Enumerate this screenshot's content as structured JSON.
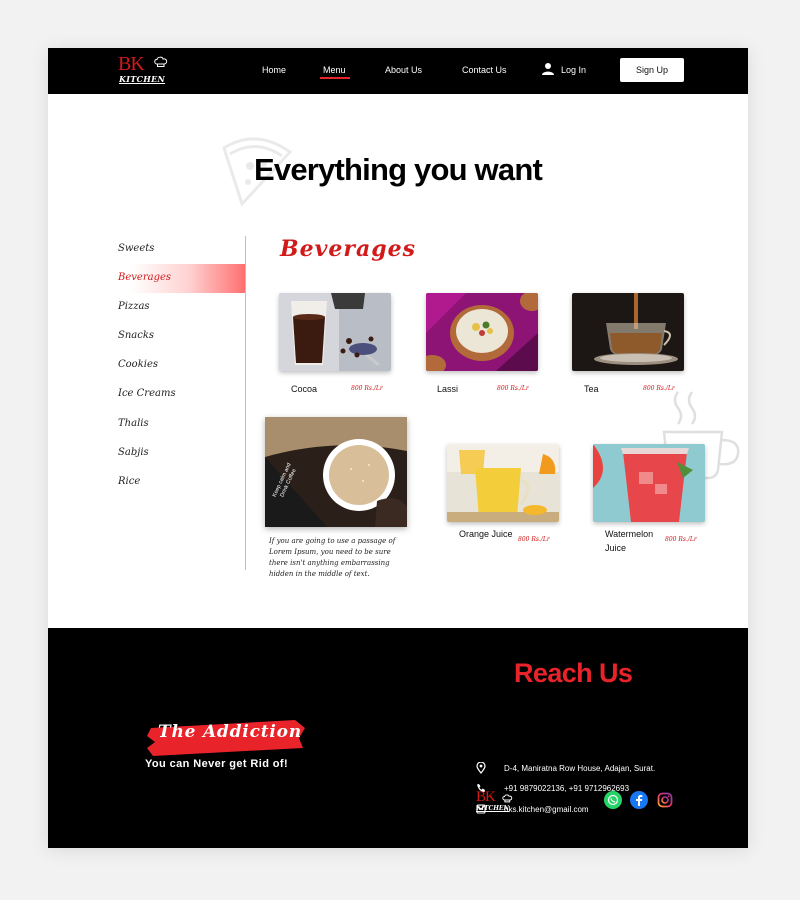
{
  "brand": {
    "logo_text": "BK",
    "logo_sub": "KITCHEN"
  },
  "nav": {
    "home": "Home",
    "menu": "Menu",
    "about": "About Us",
    "contact": "Contact Us",
    "login": "Log In",
    "signup": "Sign Up",
    "active": "Menu"
  },
  "hero": {
    "title": "Everything you want"
  },
  "sidebar": {
    "items": [
      "Sweets",
      "Beverages",
      "Pizzas",
      "Snacks",
      "Cookies",
      "Ice Creams",
      "Thalis",
      "Sabjis",
      "Rice"
    ],
    "active": "Beverages"
  },
  "content": {
    "section_title": "Beverages",
    "items": [
      {
        "name": "Cocoa",
        "price": "800 Rs./Lr"
      },
      {
        "name": "Lassi",
        "price": "800 Rs./Lr"
      },
      {
        "name": "Tea",
        "price": "800 Rs./Lr"
      },
      {
        "name": "Orange Juice",
        "price": "800 Rs./Lr"
      },
      {
        "name": "Watermelon Juice",
        "price": "800 Rs./Lr"
      }
    ],
    "featured": {
      "image_caption": "Keep calm and Drink Coffee",
      "text": "If you are going to use a passage of Lorem Ipsum, you need to be sure there isn't anything embarrassing hidden in the middle of text."
    }
  },
  "footer": {
    "addiction": "The Addiction",
    "tagline": "You can Never get Rid of!",
    "reach_title": "Reach Us",
    "address": "D-4, Maniratna Row House, Adajan, Surat.",
    "phone": "+91 9879022136, +91 9712962693",
    "email": "bks.kitchen@gmail.com",
    "social": [
      "whatsapp-icon",
      "facebook-icon",
      "instagram-icon"
    ]
  },
  "colors": {
    "accent": "#e8232a",
    "dark": "#000000",
    "whatsapp": "#25d366",
    "facebook": "#1877f2"
  }
}
